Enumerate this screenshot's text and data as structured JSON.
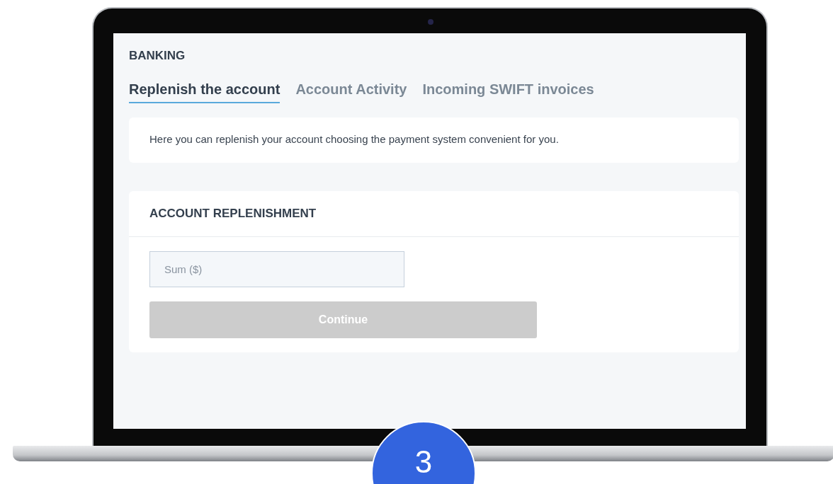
{
  "section_title": "BANKING",
  "tabs": [
    {
      "label": "Replenish the account",
      "selected": true
    },
    {
      "label": "Account Activity",
      "selected": false
    },
    {
      "label": "Incoming SWIFT invoices",
      "selected": false
    }
  ],
  "info_text": "Here you can replenish your account choosing the payment system convenient for you.",
  "replenishment": {
    "title": "ACCOUNT REPLENISHMENT",
    "sum_field": {
      "placeholder": "Sum ($)"
    },
    "continue_button": {
      "label": "Continue",
      "disabled": true
    }
  },
  "step_badge": "3"
}
